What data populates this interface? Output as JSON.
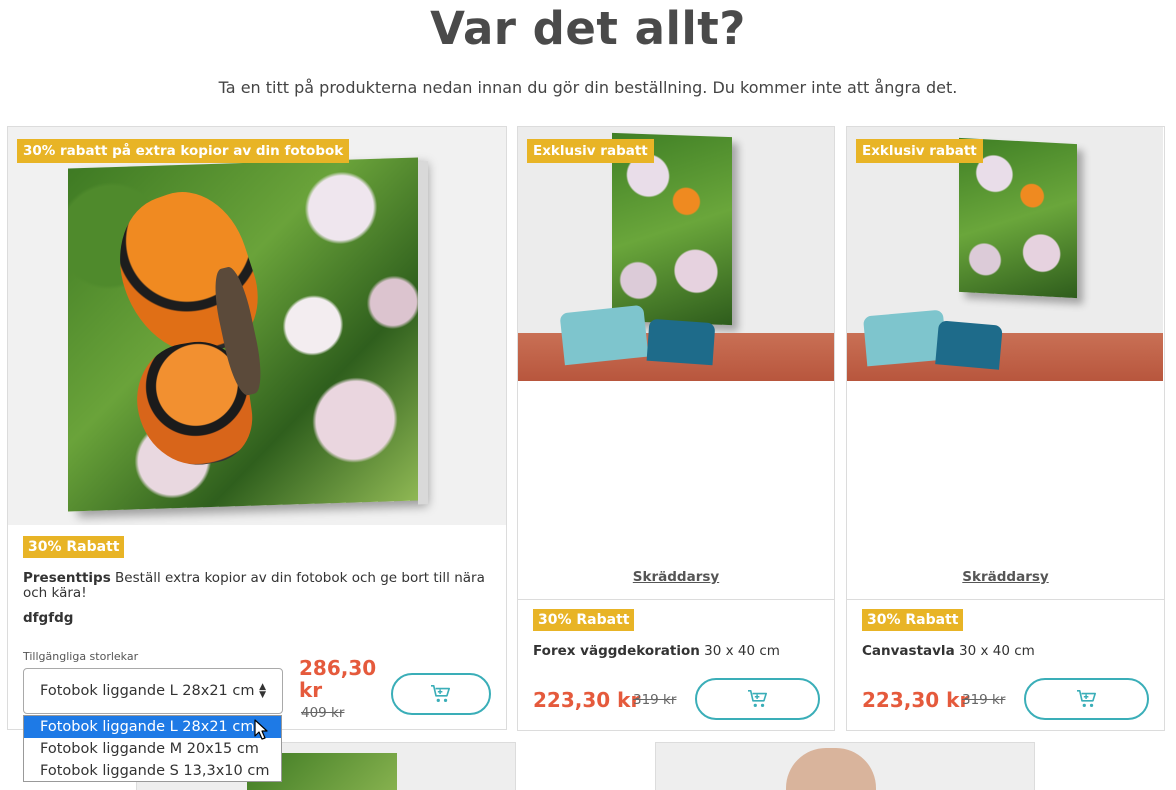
{
  "page": {
    "title": "Var det allt?",
    "subtitle": "Ta en titt på produkterna nedan innan du gör din beställning. Du kommer inte att ångra det."
  },
  "products": [
    {
      "promo_tag": "30% rabatt på extra kopior av din fotobok",
      "badge": "30% Rabatt",
      "desc_bold": "Presenttips",
      "desc": "Beställ extra kopior av din fotobok och ge bort till nära och kära!",
      "note": "dfgfdg",
      "select_label": "Tillgängliga storlekar",
      "select_value": "Fotobok liggande L 28x21 cm",
      "price": "286,30 kr",
      "old_price": "409 kr",
      "options": [
        "Fotobok liggande L 28x21 cm",
        "Fotobok liggande M 20x15 cm",
        "Fotobok liggande S 13,3x10 cm"
      ]
    },
    {
      "promo_tag": "Exklusiv rabatt",
      "link": "Skräddarsy",
      "badge": "30% Rabatt",
      "name": "Forex väggdekoration",
      "size": "30 x 40 cm",
      "price": "223,30 kr",
      "old_price": "319 kr"
    },
    {
      "promo_tag": "Exklusiv rabatt",
      "link": "Skräddarsy",
      "badge": "30% Rabatt",
      "name": "Canvastavla",
      "size": "30 x 40 cm",
      "price": "223,30 kr",
      "old_price": "319 kr"
    }
  ],
  "icons": {
    "cart": "shopping-cart-icon",
    "cursor": "mouse-pointer-icon"
  },
  "colors": {
    "accent": "#e8b426",
    "price": "#e55a3c",
    "button": "#3aaeb8",
    "selected": "#1e7ae6"
  }
}
